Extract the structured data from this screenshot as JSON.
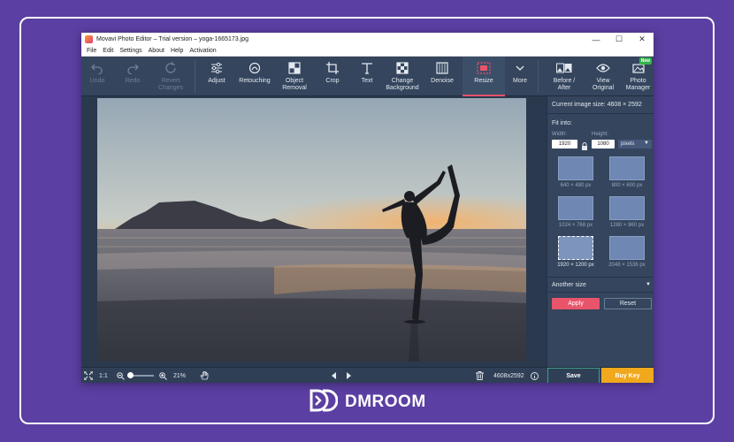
{
  "window": {
    "title": "Movavi Photo Editor – Trial version – yoga-1665173.jpg",
    "controls": {
      "minimize": "—",
      "maximize": "☐",
      "close": "✕"
    }
  },
  "menu": [
    "File",
    "Edit",
    "Settings",
    "About",
    "Help",
    "Activation"
  ],
  "toolbar": {
    "undo": "Undo",
    "redo": "Redo",
    "revert": "Revert\nChanges",
    "adjust": "Adjust",
    "retouching": "Retouching",
    "object_removal": "Object\nRemoval",
    "crop": "Crop",
    "text": "Text",
    "change_background": "Change\nBackground",
    "denoise": "Denoise",
    "resize": "Resize",
    "more": "More",
    "before_after": "Before /\nAfter",
    "view_original": "View\nOriginal",
    "photo_manager": "Photo\nManager",
    "new_badge": "New"
  },
  "panel": {
    "current_size": "Current image size: 4608 × 2592",
    "fit_into": "Fit into:",
    "width_label": "Width:",
    "height_label": "Height:",
    "width_value": "1920",
    "height_value": "1080",
    "unit": "pixels",
    "presets": [
      {
        "label": "640 × 480 px"
      },
      {
        "label": "800 × 600 px"
      },
      {
        "label": "1024 × 768 px"
      },
      {
        "label": "1280 × 960 px"
      },
      {
        "label": "1920 × 1200 px"
      },
      {
        "label": "2048 × 1536 px"
      }
    ],
    "selected_preset": 4,
    "another_size": "Another size",
    "apply": "Apply",
    "reset": "Reset"
  },
  "statusbar": {
    "ratio": "1:1",
    "zoom": "21%",
    "dimensions": "4608x2592",
    "save": "Save",
    "buy_key": "Buy Key"
  },
  "brand": {
    "name": "DMROOM"
  },
  "colors": {
    "background": "#5b3fa2",
    "accent": "#e8546a",
    "buy": "#f0a81c",
    "save_border": "#3aa089"
  }
}
